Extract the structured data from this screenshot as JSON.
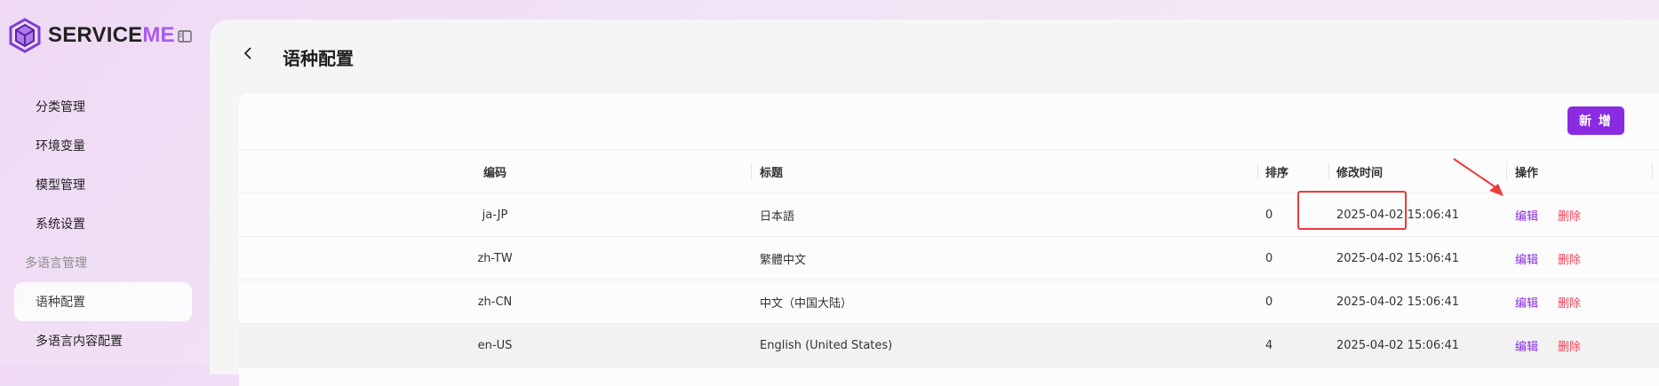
{
  "brand": {
    "name_main": "SERVICE",
    "name_accent": "ME",
    "accent_color": "#a85cf0",
    "logo_icon": "cube-logo-icon"
  },
  "sidebar": {
    "collapse_icon": "sidebar-collapse-icon",
    "items": [
      {
        "label": "分类管理",
        "type": "item"
      },
      {
        "label": "环境变量",
        "type": "item"
      },
      {
        "label": "模型管理",
        "type": "item"
      },
      {
        "label": "系统设置",
        "type": "item"
      },
      {
        "label": "多语言管理",
        "type": "group"
      },
      {
        "label": "语种配置",
        "type": "item",
        "active": true
      },
      {
        "label": "多语言内容配置",
        "type": "item"
      }
    ]
  },
  "header": {
    "back_icon": "chevron-left-icon",
    "title": "语种配置"
  },
  "toolbar": {
    "add_label": "新 增",
    "add_color": "#8a2be2"
  },
  "table": {
    "columns": [
      "编码",
      "标题",
      "排序",
      "修改时间",
      "操作"
    ],
    "rows": [
      {
        "code": "ja-JP",
        "title": "日本語",
        "order": "0",
        "modified": "2025-04-02 15:06:41",
        "edit": "编辑",
        "delete": "删除"
      },
      {
        "code": "zh-TW",
        "title": "繁體中文",
        "order": "0",
        "modified": "2025-04-02 15:06:41",
        "edit": "编辑",
        "delete": "删除"
      },
      {
        "code": "zh-CN",
        "title": "中文（中国大陆）",
        "order": "0",
        "modified": "2025-04-02 15:06:41",
        "edit": "编辑",
        "delete": "删除"
      },
      {
        "code": "en-US",
        "title": "English (United States)",
        "order": "4",
        "modified": "2025-04-02 15:06:41",
        "edit": "编辑",
        "delete": "删除"
      }
    ]
  },
  "annotation": {
    "color": "#ec3b3b"
  }
}
